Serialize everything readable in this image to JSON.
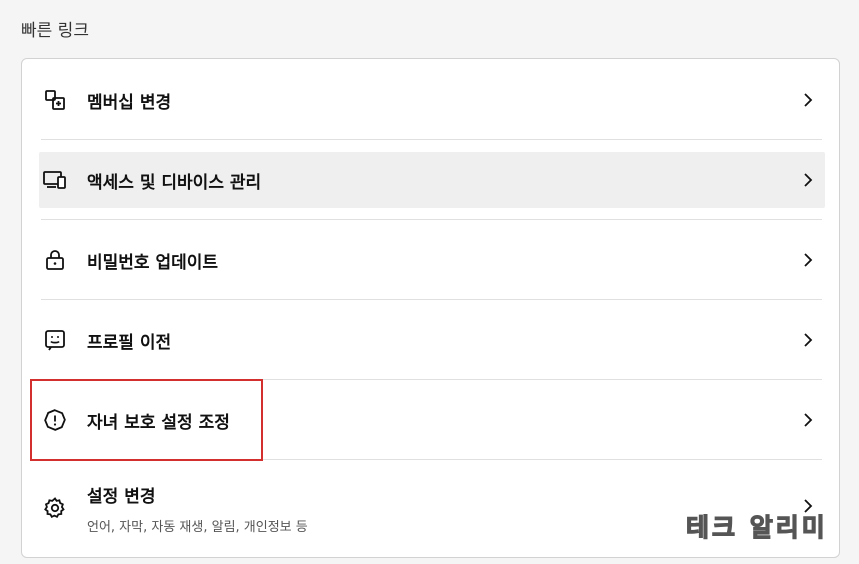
{
  "section": {
    "title": "빠른 링크"
  },
  "items": [
    {
      "label": "멤버십 변경",
      "icon": "membership-change-icon"
    },
    {
      "label": "액세스 및 디바이스 관리",
      "icon": "devices-icon",
      "hovered": true
    },
    {
      "label": "비밀번호 업데이트",
      "icon": "lock-icon"
    },
    {
      "label": "프로필 이전",
      "icon": "profile-transfer-icon"
    },
    {
      "label": "자녀 보호 설정 조정",
      "icon": "warning-octagon-icon",
      "highlighted": true,
      "highlight_color": "#d32f2f"
    },
    {
      "label": "설정 변경",
      "sublabel": "언어, 자막, 자동 재생, 알림, 개인정보 등",
      "icon": "gear-icon"
    }
  ],
  "watermark": "테크 알리미"
}
